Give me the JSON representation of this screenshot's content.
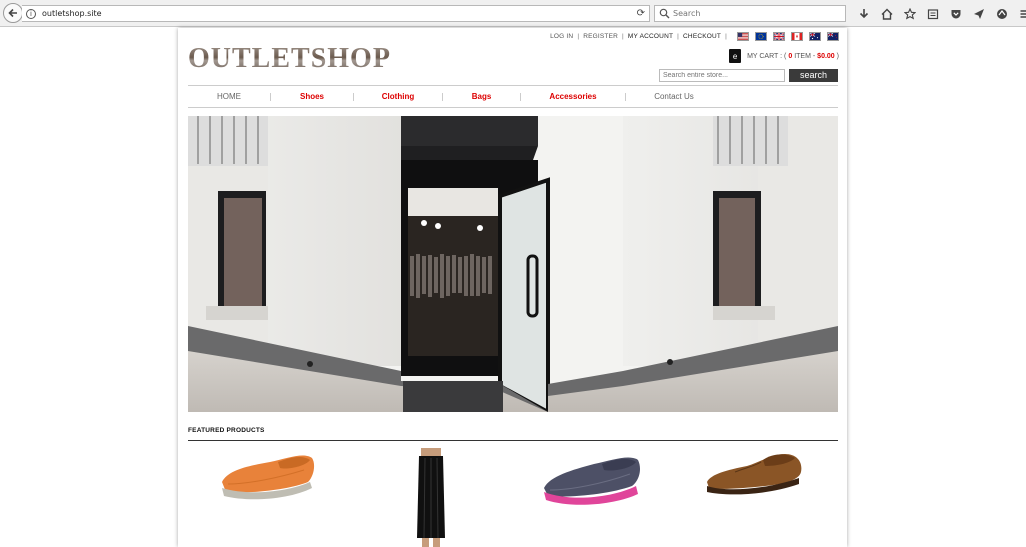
{
  "browser": {
    "url": "outletshop.site",
    "search_placeholder": "Search",
    "toolbar_icons": [
      "download-icon",
      "home-icon",
      "bookmark-star-icon",
      "reading-list-icon",
      "pocket-icon",
      "send-icon",
      "extension-icon",
      "menu-icon"
    ]
  },
  "header": {
    "top_links": [
      "LOG IN",
      "REGISTER",
      "MY ACCOUNT",
      "CHECKOUT"
    ],
    "logo": "OUTLETSHOP",
    "cart": {
      "label": "MY CART :",
      "open": "(",
      "count": "0",
      "item_word": "ITEM",
      "dash": "-",
      "total": "$0.00",
      "close": ")",
      "bag_letter": "e"
    },
    "store_search_placeholder": "Search entire store...",
    "search_button": "search",
    "flags": [
      "us",
      "eu",
      "uk",
      "ca",
      "au",
      "nz"
    ]
  },
  "nav": {
    "items": [
      {
        "label": "HOME",
        "style": "gray"
      },
      {
        "label": "Shoes",
        "style": "red"
      },
      {
        "label": "Clothing",
        "style": "red"
      },
      {
        "label": "Bags",
        "style": "red"
      },
      {
        "label": "Accessories",
        "style": "red"
      },
      {
        "label": "Contact Us",
        "style": "gray"
      }
    ]
  },
  "featured": {
    "title": "FEATURED PRODUCTS",
    "products": [
      "orange-slip-on-shoe",
      "black-maxi-skirt",
      "navy-pink-slip-on-shoe",
      "brown-leather-brogue"
    ]
  },
  "colors": {
    "accent_red": "#dd0000",
    "button_dark": "#3a3a3a"
  }
}
